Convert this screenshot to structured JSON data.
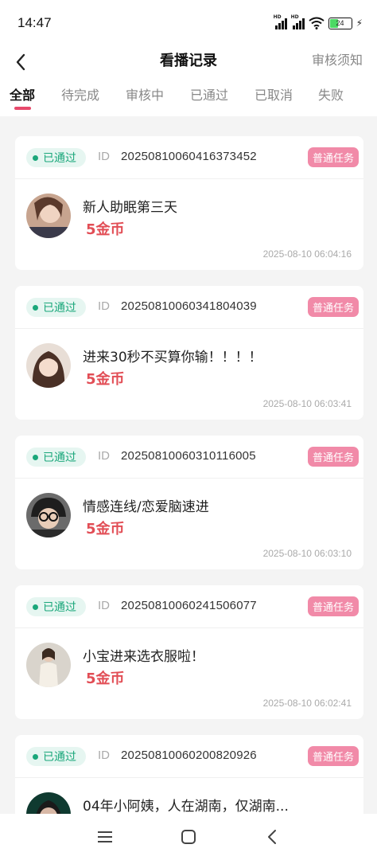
{
  "status_bar": {
    "time": "14:47",
    "battery": "24",
    "hd1": "HD",
    "hd2": "HD"
  },
  "header": {
    "title": "看播记录",
    "right_link": "审核须知"
  },
  "tabs": [
    {
      "label": "全部",
      "active": true
    },
    {
      "label": "待完成"
    },
    {
      "label": "审核中"
    },
    {
      "label": "已通过"
    },
    {
      "label": "已取消"
    },
    {
      "label": "失败"
    }
  ],
  "accent_color": "#e7496b",
  "records": [
    {
      "status": "已通过",
      "id_label": "ID",
      "id": "20250810060416373452",
      "type": "普通任务",
      "title": "新人助眠第三天",
      "reward": "5金币",
      "time": "2025-08-10 06:04:16"
    },
    {
      "status": "已通过",
      "id_label": "ID",
      "id": "20250810060341804039",
      "type": "普通任务",
      "title": "进来30秒不买算你输！！！！",
      "reward": "5金币",
      "time": "2025-08-10 06:03:41"
    },
    {
      "status": "已通过",
      "id_label": "ID",
      "id": "20250810060310116005",
      "type": "普通任务",
      "title": "情感连线/恋爱脑速进",
      "reward": "5金币",
      "time": "2025-08-10 06:03:10"
    },
    {
      "status": "已通过",
      "id_label": "ID",
      "id": "20250810060241506077",
      "type": "普通任务",
      "title": "小宝进来选衣服啦！",
      "reward": "5金币",
      "time": "2025-08-10 06:02:41"
    },
    {
      "status": "已通过",
      "id_label": "ID",
      "id": "20250810060200820926",
      "type": "普通任务",
      "title": "04年小阿姨，人在湖南，仅湖南...",
      "reward": "",
      "time": ""
    }
  ],
  "icons": {
    "back": "chevron-left-icon",
    "menu": "menu-icon",
    "home": "home-square-icon",
    "nav_back": "nav-back-icon"
  }
}
